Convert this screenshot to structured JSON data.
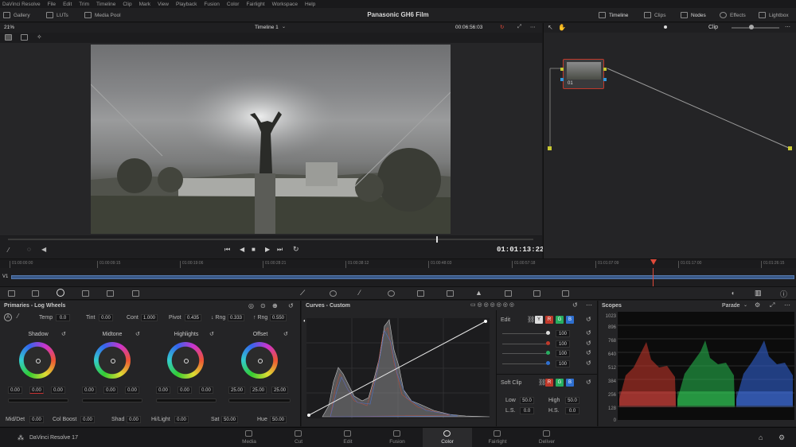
{
  "menubar": {
    "items": [
      "DaVinci Resolve",
      "File",
      "Edit",
      "Trim",
      "Timeline",
      "Clip",
      "Mark",
      "View",
      "Playback",
      "Fusion",
      "Color",
      "Fairlight",
      "Workspace",
      "Help"
    ]
  },
  "toolbar": {
    "gallery": "Gallery",
    "luts": "LUTs",
    "media_pool": "Media Pool",
    "project_title": "Panasonic GH6 Film",
    "timeline": "Timeline",
    "clips": "Clips",
    "nodes": "Nodes",
    "effects": "Effects",
    "lightbox": "Lightbox"
  },
  "viewer": {
    "zoom": "21%",
    "timeline_name": "Timeline 1",
    "timecode_top": "00:06:56:03",
    "timecode_main": "01:01:13:22"
  },
  "node_panel": {
    "mode": "Clip",
    "node_label": "01"
  },
  "ruler": {
    "ticks": [
      "01:00:00:00",
      "01:00:09:15",
      "01:00:19:06",
      "01:00:28:21",
      "01:00:38:12",
      "01:00:48:03",
      "01:00:57:18",
      "01:01:07:09",
      "01:01:17:00",
      "01:01:26:15"
    ]
  },
  "track": {
    "label": "V1"
  },
  "primaries": {
    "title": "Primaries - Log Wheels",
    "temp_label": "Temp",
    "temp": "0.0",
    "tint_label": "Tint",
    "tint": "0.00",
    "cont_label": "Cont",
    "cont": "1.000",
    "pivot_label": "Pivot",
    "pivot": "0.435",
    "lrng_label": "↓ Rng",
    "lrng": "0.333",
    "hrng_label": "↑ Rng",
    "hrng": "0.550",
    "wheels": [
      {
        "name": "Shadow",
        "values": [
          "0.00",
          "0.00",
          "0.00"
        ]
      },
      {
        "name": "Midtone",
        "values": [
          "0.00",
          "0.00",
          "0.00"
        ]
      },
      {
        "name": "Highlights",
        "values": [
          "0.00",
          "0.00",
          "0.00"
        ]
      },
      {
        "name": "Offset",
        "values": [
          "25.00",
          "25.00",
          "25.00"
        ]
      }
    ],
    "middet_label": "Mid/Det",
    "middet": "0.00",
    "colboost_label": "Col Boost",
    "colboost": "0.00",
    "shad_label": "Shad",
    "shad": "0.00",
    "hilight_label": "Hi/Light",
    "hilight": "0.00",
    "sat_label": "Sat",
    "sat": "50.00",
    "hue_label": "Hue",
    "hue": "50.00"
  },
  "curves": {
    "title": "Curves - Custom",
    "edit_label": "Edit",
    "channels": [
      "Y",
      "R",
      "G",
      "B"
    ],
    "intensities": [
      "100",
      "100",
      "100",
      "100"
    ],
    "softclip_label": "Soft Clip",
    "low_label": "Low",
    "low": "50.0",
    "high_label": "High",
    "high": "50.0",
    "ls_label": "L.S.",
    "ls": "0.0",
    "hs_label": "H.S.",
    "hs": "0.0"
  },
  "scopes": {
    "title": "Scopes",
    "mode": "Parade",
    "scale": [
      "1023",
      "896",
      "768",
      "640",
      "512",
      "384",
      "256",
      "128",
      "0"
    ]
  },
  "bottombar": {
    "app": "DaVinci Resolve 17",
    "pages": [
      "Media",
      "Cut",
      "Edit",
      "Fusion",
      "Color",
      "Fairlight",
      "Deliver"
    ],
    "active_page": "Color"
  },
  "colors": {
    "accent": "#e0493a",
    "playhead": "#e04a3a",
    "track": "#3a5a8a"
  }
}
